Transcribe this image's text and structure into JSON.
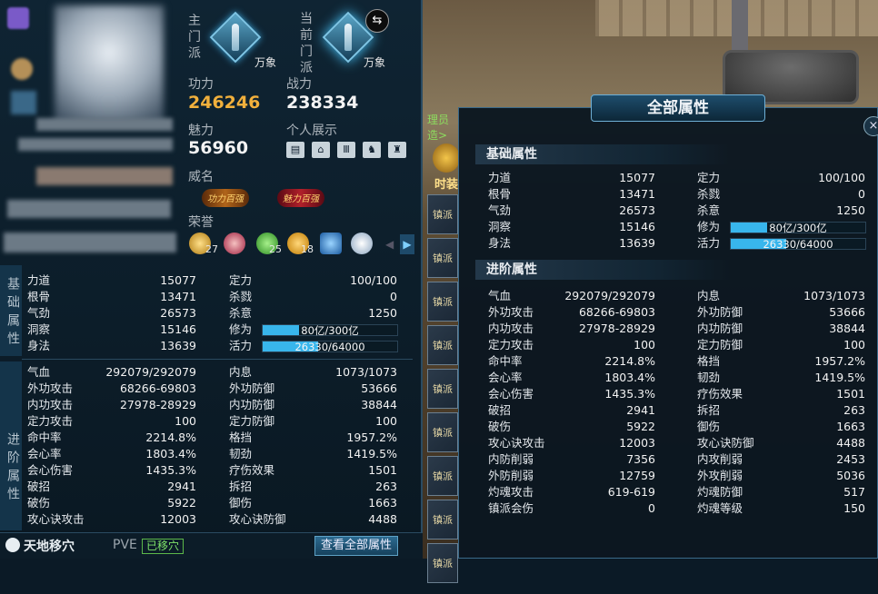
{
  "left_panel": {
    "main_sect_label": "主门派",
    "main_sect_name": "万象",
    "current_sect_label": "当前门派",
    "current_sect_name": "万象",
    "gongli_label": "功力",
    "gongli_value": "246246",
    "zhanli_label": "战力",
    "zhanli_value": "238334",
    "meili_label": "魅力",
    "meili_value": "56960",
    "personal_show_label": "个人展示",
    "weiming_label": "威名",
    "badges": [
      "功力百强",
      "魅力百强"
    ],
    "honor_label": "荣誉",
    "honors": [
      {
        "icon": "crown-icon",
        "count": "27"
      },
      {
        "icon": "lantern-icon",
        "count": ""
      },
      {
        "icon": "ji-icon",
        "count": "25"
      },
      {
        "icon": "shuai-icon",
        "count": "18"
      },
      {
        "icon": "bang-icon",
        "count": ""
      },
      {
        "icon": "crystal-icon",
        "count": ""
      }
    ],
    "basic_label": "基础属性",
    "advanced_label": "进阶属性",
    "footer": {
      "location": "天地移穴",
      "mode": "PVE",
      "status": "已移穴",
      "view_all_button": "查看全部属性"
    }
  },
  "basic_stats": [
    {
      "k1": "力道",
      "v1": "15077",
      "k2": "定力",
      "v2": "100/100"
    },
    {
      "k1": "根骨",
      "v1": "13471",
      "k2": "杀戮",
      "v2": "0"
    },
    {
      "k1": "气劲",
      "v1": "26573",
      "k2": "杀意",
      "v2": "1250"
    },
    {
      "k1": "洞察",
      "v1": "15146",
      "k2": "修为",
      "v2": "80亿/300亿"
    },
    {
      "k1": "身法",
      "v1": "13639",
      "k2": "活力",
      "v2": "26330/64000"
    }
  ],
  "bars": {
    "xiuwei_fraction": 0.27,
    "huoli_fraction": 0.41
  },
  "advanced_stats": [
    {
      "k1": "气血",
      "v1": "292079/292079",
      "k2": "内息",
      "v2": "1073/1073"
    },
    {
      "k1": "外功攻击",
      "v1": "68266-69803",
      "k2": "外功防御",
      "v2": "53666"
    },
    {
      "k1": "内功攻击",
      "v1": "27978-28929",
      "k2": "内功防御",
      "v2": "38844"
    },
    {
      "k1": "定力攻击",
      "v1": "100",
      "k2": "定力防御",
      "v2": "100"
    },
    {
      "k1": "命中率",
      "v1": "2214.8%",
      "k2": "格挡",
      "v2": "1957.2%"
    },
    {
      "k1": "会心率",
      "v1": "1803.4%",
      "k2": "韧劲",
      "v2": "1419.5%"
    },
    {
      "k1": "会心伤害",
      "v1": "1435.3%",
      "k2": "疗伤效果",
      "v2": "1501"
    },
    {
      "k1": "破招",
      "v1": "2941",
      "k2": "拆招",
      "v2": "263"
    },
    {
      "k1": "破伤",
      "v1": "5922",
      "k2": "御伤",
      "v2": "1663"
    },
    {
      "k1": "攻心诀攻击",
      "v1": "12003",
      "k2": "攻心诀防御",
      "v2": "4488"
    },
    {
      "k1": "内防削弱",
      "v1": "7356",
      "k2": "内攻削弱",
      "v2": "2453"
    },
    {
      "k1": "外防削弱",
      "v1": "12759",
      "k2": "外攻削弱",
      "v2": "5036"
    },
    {
      "k1": "灼魂攻击",
      "v1": "619-619",
      "k2": "灼魂防御",
      "v2": "517"
    },
    {
      "k1": "镇派会伤",
      "v1": "0",
      "k2": "灼魂等级",
      "v2": "150"
    }
  ],
  "right_panel": {
    "title": "全部属性",
    "basic_header": "基础属性",
    "advanced_header": "进阶属性",
    "close": "×"
  },
  "scene": {
    "npc_label": "理员",
    "npc_label2": "造>",
    "side_button": "时装",
    "side_items": [
      "镇派",
      "镇派",
      "镇派",
      "镇派",
      "镇派",
      "镇派",
      "镇派",
      "镇派",
      "镇派"
    ]
  }
}
